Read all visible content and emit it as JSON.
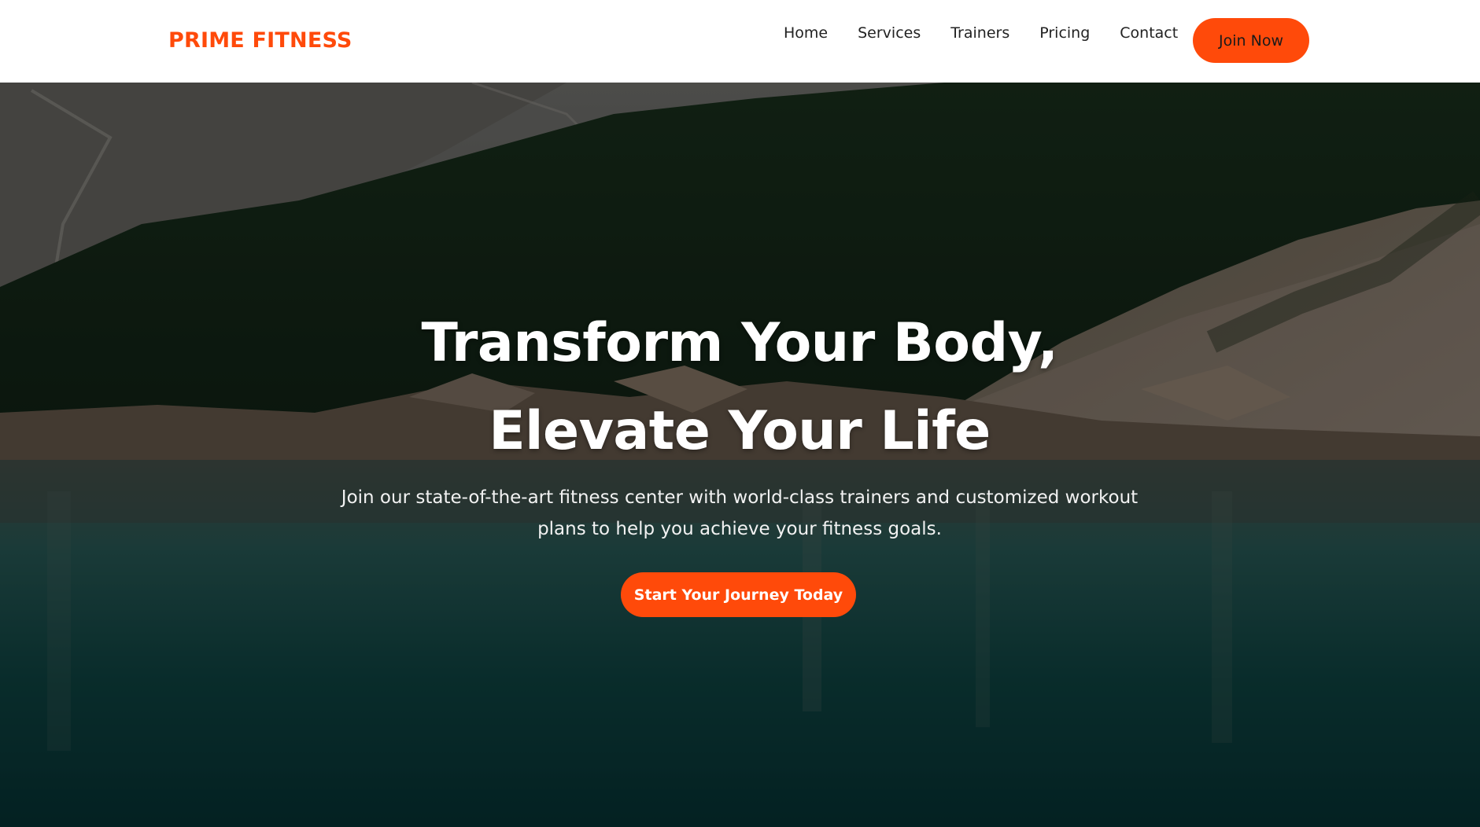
{
  "colors": {
    "accent": "#ff4a0a",
    "nav_bg": "#ffffff",
    "nav_text": "#222222",
    "hero_text": "#ffffff"
  },
  "navbar": {
    "brand": "PRIME FITNESS",
    "links": [
      "Home",
      "Services",
      "Trainers",
      "Pricing",
      "Contact"
    ],
    "join_label": "Join Now"
  },
  "hero": {
    "background_image": "mountain-lake-forest-photo",
    "title": "Transform Your Body, Elevate Your Life",
    "subtitle": "Join our state-of-the-art fitness center with world-class trainers and customized workout plans to help you achieve your fitness goals.",
    "cta_label": "Start Your Journey Today"
  }
}
